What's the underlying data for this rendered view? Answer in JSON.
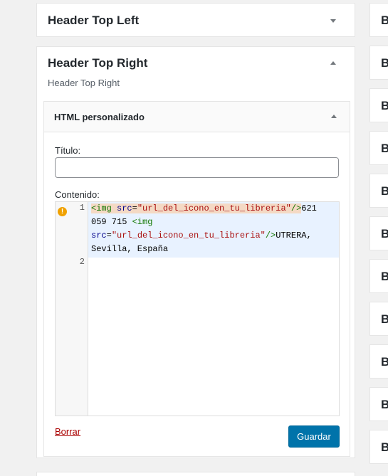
{
  "panels": {
    "top_left": {
      "title": "Header Top Left"
    },
    "top_right": {
      "title": "Header Top Right",
      "description": "Header Top Right"
    }
  },
  "widget": {
    "title": "HTML personalizado",
    "title_label": "Título:",
    "title_value": "",
    "content_label": "Contenido:",
    "editor": {
      "line_numbers": [
        "1",
        "2"
      ],
      "warning_icon": "warning-icon",
      "line1": {
        "tag_open": "<img",
        "attr1": "src",
        "eq1": "=",
        "str1": "\"url_del_icono_en_tu_libreria\"",
        "close1": "/>",
        "text1": "621 059 715 ",
        "tag2": "<img",
        "attr2": "src",
        "eq2": "=",
        "str2": "\"url_del_icono_en_tu_libreria\"",
        "close2": "/>",
        "text2": "UTRERA, Sevilla, España"
      },
      "line2": ""
    },
    "delete_label": "Borrar",
    "save_label": "Guardar"
  },
  "right_column": {
    "items": [
      "B",
      "B",
      "B",
      "B",
      "B",
      "B",
      "B",
      "B",
      "B",
      "B",
      "B"
    ]
  },
  "colors": {
    "save_button": "#0073aa",
    "delete_link": "#aa0000",
    "warning": "#f0a100",
    "active_line": "#e8f2ff"
  }
}
